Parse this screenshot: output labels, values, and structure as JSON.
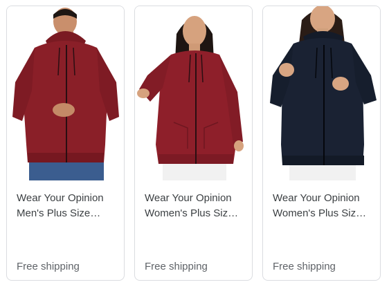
{
  "products": [
    {
      "title_line1": "Wear Your Opinion",
      "title_line2": "Men's Plus Size…",
      "shipping": "Free shipping",
      "image_icon": "mens-maroon-zip-hoodie-image",
      "hoodie_color": "#8a1f28",
      "pants_color": "#3b5d8f"
    },
    {
      "title_line1": "Wear Your Opinion",
      "title_line2": "Women's Plus Siz…",
      "shipping": "Free shipping",
      "image_icon": "womens-maroon-zip-hoodie-image",
      "hoodie_color": "#8e1f2a",
      "pants_color": "#f1f1f1"
    },
    {
      "title_line1": "Wear Your Opinion",
      "title_line2": "Women's Plus Siz…",
      "shipping": "Free shipping",
      "image_icon": "womens-navy-zip-hoodie-image",
      "hoodie_color": "#1a2233",
      "pants_color": "#f1f1f1"
    }
  ]
}
